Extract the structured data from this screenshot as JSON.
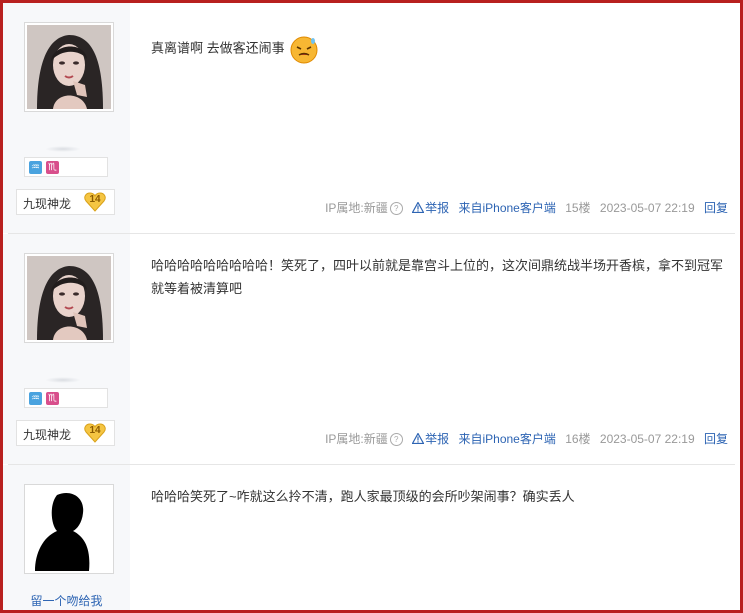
{
  "posts": [
    {
      "username": "九现神龙",
      "level": "14",
      "text": "真离谱啊 去做客还闹事",
      "ip": "IP属地:新疆",
      "report": "举报",
      "source": "来自iPhone客户端",
      "floor": "15楼",
      "time": "2023-05-07 22:19",
      "reply": "回复",
      "badges": [
        "♒",
        "♏"
      ]
    },
    {
      "username": "九现神龙",
      "level": "14",
      "text": "哈哈哈哈哈哈哈哈哈！笑死了，四叶以前就是靠宫斗上位的，这次间鼎统战半场开香槟，拿不到冠军就等着被清算吧",
      "ip": "IP属地:新疆",
      "report": "举报",
      "source": "来自iPhone客户端",
      "floor": "16楼",
      "time": "2023-05-07 22:19",
      "reply": "回复",
      "badges": [
        "♒",
        "♏"
      ]
    },
    {
      "username": "留一个吻给我",
      "text": "哈哈哈笑死了~咋就这么拎不清，跑人家最顶级的会所吵架闹事？确实丢人"
    }
  ],
  "colors": {
    "border": "#b8201f",
    "link": "#2d64b3",
    "sidebar": "#f7f8fa"
  },
  "icons": [
    "avatar-woman",
    "avatar-silhouette",
    "emoji-sweat-icon",
    "aquarius-icon",
    "scorpio-icon",
    "level-heart-icon",
    "warning-icon",
    "question-icon"
  ]
}
